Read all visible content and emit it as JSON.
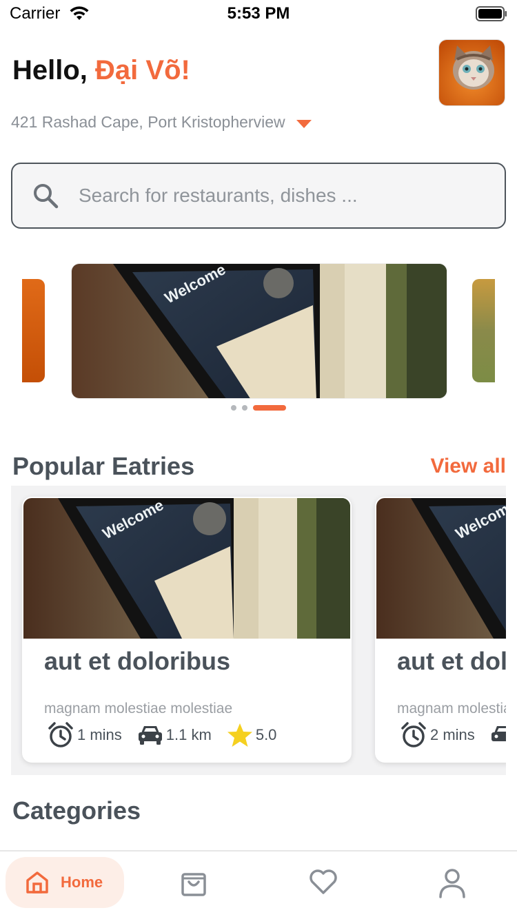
{
  "status_bar": {
    "carrier": "Carrier",
    "time": "5:53 PM"
  },
  "header": {
    "greeting_prefix": "Hello,",
    "user_name": "Đại Võ!",
    "address": "421 Rashad Cape, Port Kristopherview"
  },
  "search": {
    "placeholder": "Search for restaurants, dishes ..."
  },
  "banner": {
    "slide_count": 3,
    "active_slide": 3
  },
  "popular": {
    "title": "Popular Eatries",
    "view_all_label": "View all",
    "items": [
      {
        "name": "aut et doloribus",
        "subtitle": "magnam molestiae molestiae",
        "time": "1 mins",
        "distance": "1.1 km",
        "rating": "5.0"
      },
      {
        "name": "aut et doloribus",
        "subtitle": "magnam molestiae molestiae",
        "time": "2 mins",
        "distance": "",
        "rating": ""
      }
    ]
  },
  "categories": {
    "title": "Categories"
  },
  "nav": {
    "home_label": "Home",
    "items": [
      "home-icon",
      "bag-icon",
      "heart-icon",
      "user-icon"
    ]
  },
  "colors": {
    "accent": "#f26a3d",
    "star": "#f5d020",
    "text_dark": "#4a525a",
    "text_muted": "#8a8f96"
  }
}
